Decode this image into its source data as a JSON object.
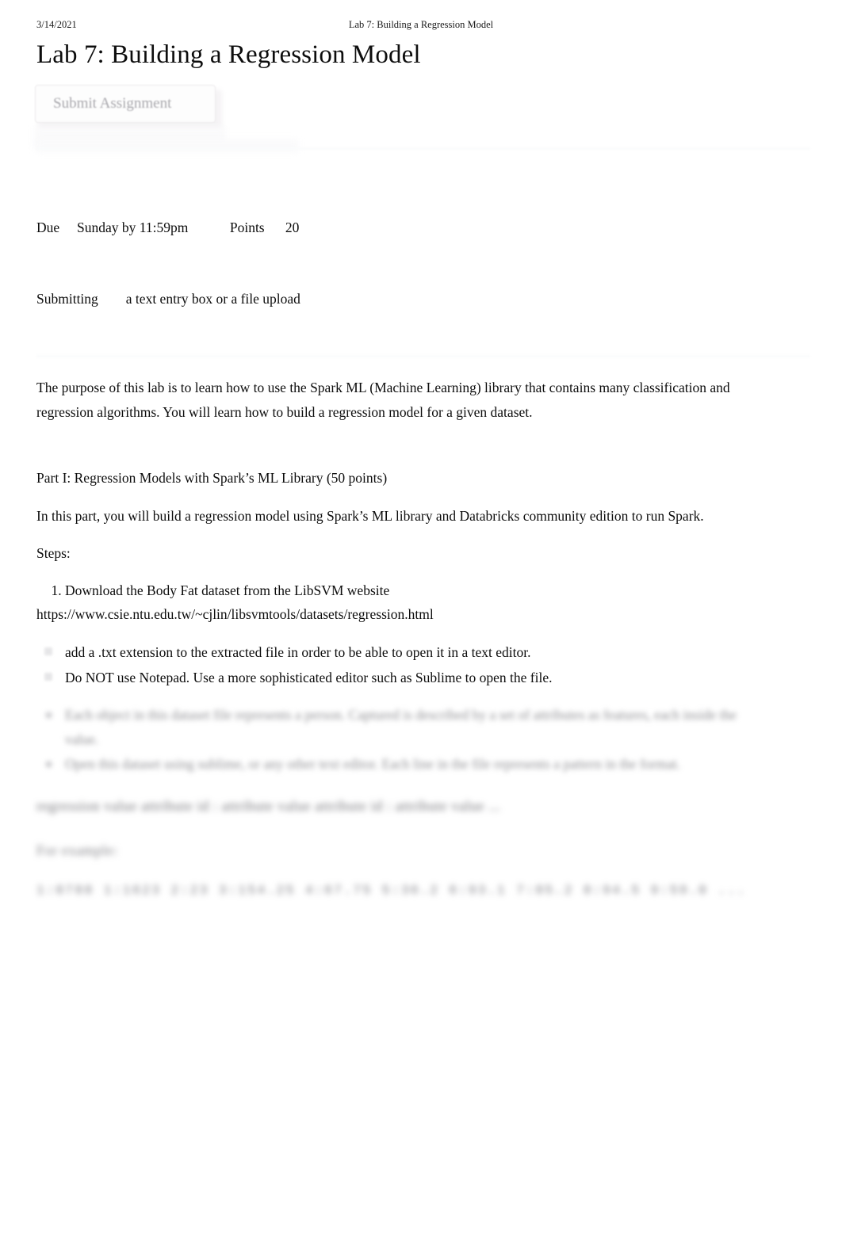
{
  "print_header": {
    "date": "3/14/2021",
    "document_title": "Lab 7: Building a Regression Model"
  },
  "page_title": "Lab 7: Building a Regression Model",
  "actions": {
    "submit_assignment_label": "Submit Assignment"
  },
  "assignment_meta": {
    "due_label": "Due",
    "due_value": "Sunday by 11:59pm",
    "points_label": "Points",
    "points_value": "20",
    "submitting_label": "Submitting",
    "submitting_value": "a text entry box or a file upload",
    "row_due": "Due     Sunday by 11:59pm            Points      20",
    "row_submitting": "Submitting        a text entry box or a file upload"
  },
  "body": {
    "intro": "The purpose of this lab is to learn how to use the Spark ML (Machine Learning) library that contains many classification and regression algorithms. You will learn how to build a regression model for a given dataset.",
    "part_heading": "Part I: Regression Models with Spark’s ML Library (50 points)",
    "part_intro": "In this part, you will build a regression model using Spark’s ML library and Databricks community edition to run Spark.",
    "steps_label": "Steps:",
    "steps": [
      "Download the Body Fat dataset from the LibSVM website"
    ],
    "dataset_url": "https://www.csie.ntu.edu.tw/~cjlin/libsvmtools/datasets/regression.html",
    "notes": [
      "add a .txt extension to the extracted file in order to be able to open it in a text editor.",
      "Do NOT use Notepad. Use a more sophisticated editor such as Sublime to open the file."
    ],
    "obscured_notes": [
      "Each object in this dataset file represents a person. Captured is described by a set of attributes as features, each inside the value.",
      "Open this dataset using sublime, or any other text editor. Each line in the file represents a pattern in the format."
    ],
    "obscured_format_line": "regression value         attribute id : attribute value        attribute id : attribute value ...",
    "obscured_example_label": "For example:",
    "obscured_example_data": "1:0788  1:1623  2:23  3:154.25  4:67.75  5:36.2  6:93.1  7:85.2  8:94.5  9:59.0 ..."
  }
}
